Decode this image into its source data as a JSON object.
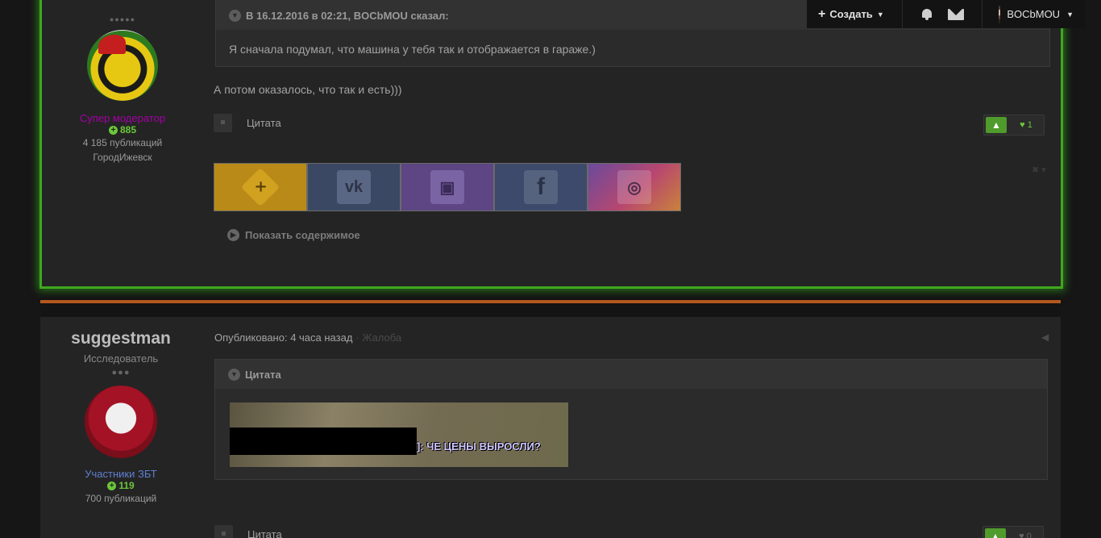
{
  "topbar": {
    "create_label": "Создать",
    "username": "BOCbMOU"
  },
  "post1": {
    "author": {
      "role": "Супер модератор",
      "reputation": "885",
      "posts": "4 185 публикаций",
      "city": "ГородИжевск"
    },
    "quote": {
      "header": "В 16.12.2016 в 02:21, BOCbMOU сказал:",
      "text": "Я сначала подумал, что машина у тебя так и отображается в гараже.)"
    },
    "body": "А потом оказалось, что так и есть)))",
    "quote_button": "Цитата",
    "likes": "1",
    "show_content": "Показать содержимое"
  },
  "post2": {
    "author": {
      "name": "suggestman",
      "rank": "Исследователь",
      "role": "Участники ЗБТ",
      "reputation": "119",
      "posts": "700 публикаций"
    },
    "published": "Опубликовано: 4 часа назад",
    "report": "· Жалоба",
    "quote_header": "Цитата",
    "image_caption": "]: ЧЕ ЦЕНЫ ВЫРОСЛИ?",
    "quote_button": "Цитата",
    "likes": "0"
  },
  "colors": {
    "accent_green": "#3fa71f",
    "separator_orange": "#b4591f",
    "supermod_purple": "#a400a4",
    "zbt_blue": "#5f7fd0"
  }
}
